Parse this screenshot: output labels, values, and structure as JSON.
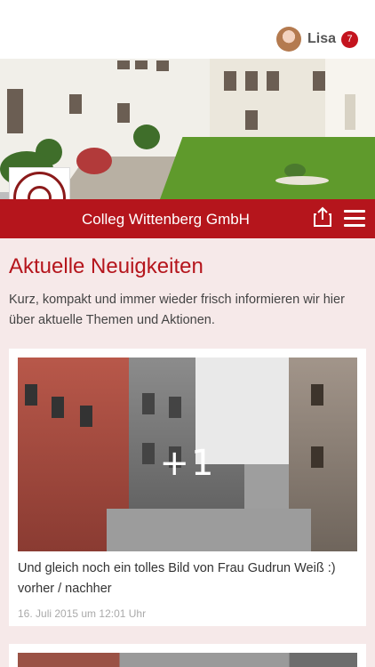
{
  "user": {
    "name": "Lisa",
    "notifications": "7"
  },
  "company": {
    "name": "Colleg Wittenberg GmbH"
  },
  "header": {
    "share_icon": "share-icon",
    "menu_icon": "hamburger-menu-icon"
  },
  "main": {
    "title": "Aktuelle Neuigkeiten",
    "intro": "Kurz, kompakt und immer wieder frisch informieren wir hier über aktuelle Themen und Aktionen.",
    "posts": [
      {
        "more_images": "+1",
        "text": "Und gleich noch ein tolles Bild von Frau Gudrun Weiß :) vorher / nachher",
        "date": "16. Juli 2015 um 12:01 Uhr"
      }
    ]
  },
  "colors": {
    "brand_red": "#b5151c",
    "background": "#f6e9e9",
    "badge": "#c4141e"
  }
}
